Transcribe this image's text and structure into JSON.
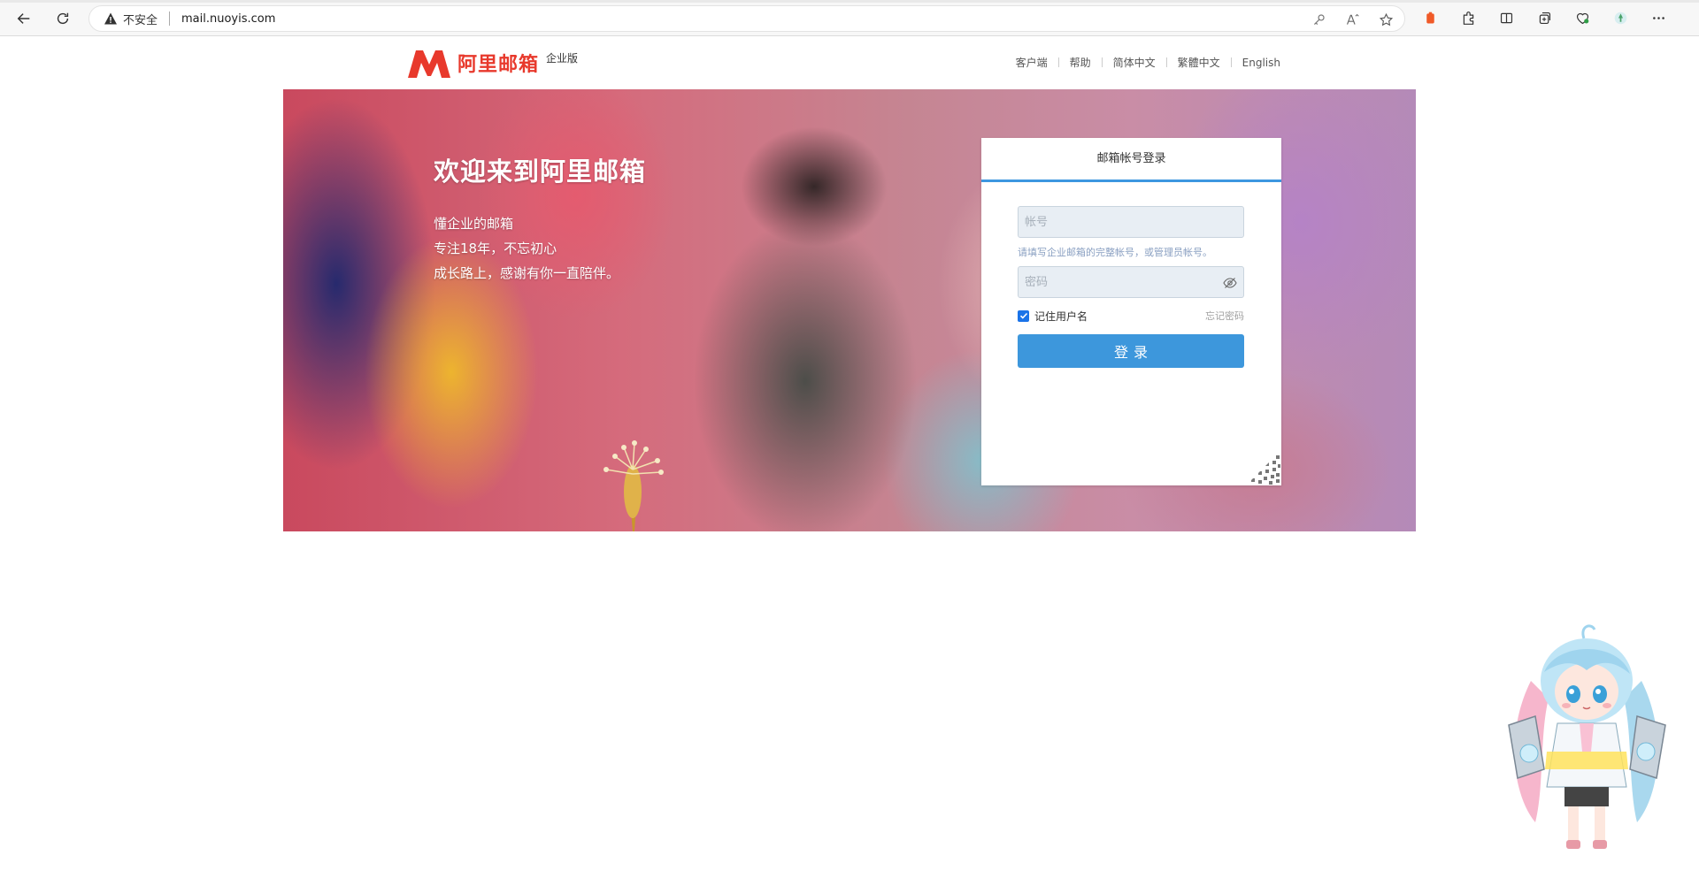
{
  "browser": {
    "security_label": "不安全",
    "url": "mail.nuoyis.com"
  },
  "header": {
    "logo_text": "阿里邮箱",
    "edition": "企业版",
    "links": [
      "客户端",
      "帮助",
      "简体中文",
      "繁體中文",
      "English"
    ]
  },
  "banner": {
    "title": "欢迎来到阿里邮箱",
    "taglines": [
      "懂企业的邮箱",
      "专注18年，不忘初心",
      "成长路上，感谢有你一直陪伴。"
    ]
  },
  "login": {
    "tab_label": "邮箱帐号登录",
    "account_placeholder": "帐号",
    "account_hint": "请填写企业邮箱的完整帐号，或管理员帐号。",
    "password_placeholder": "密码",
    "remember_label": "记住用户名",
    "remember_checked": true,
    "forgot_label": "忘记密码",
    "submit_label": "登录"
  },
  "colors": {
    "brand_red": "#e8392c",
    "primary_blue": "#3d97dc"
  }
}
